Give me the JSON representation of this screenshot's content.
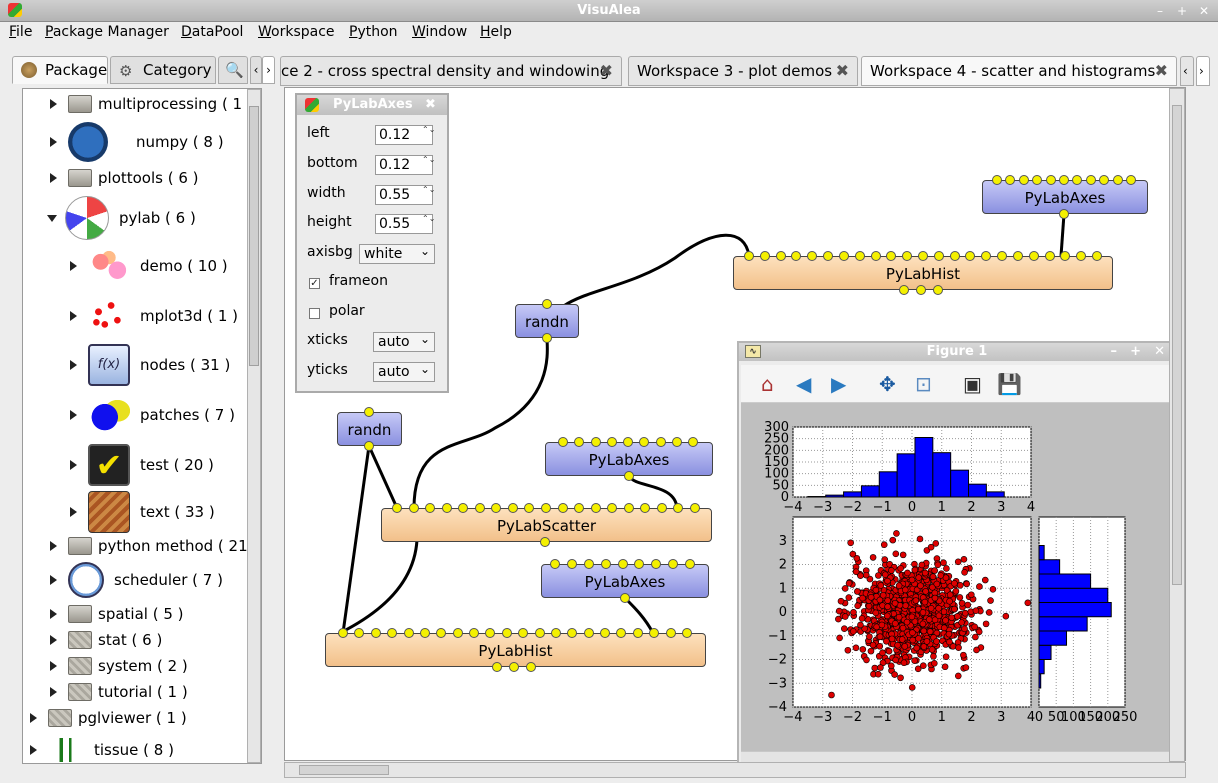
{
  "window": {
    "title": "VisuAlea"
  },
  "menu": [
    "File",
    "Package Manager",
    "DataPool",
    "Workspace",
    "Python",
    "Window",
    "Help"
  ],
  "left_tabs": {
    "package": "Package",
    "category": "Category"
  },
  "tree": [
    {
      "label": "multiprocessing ( 1 )",
      "icon": "folder-icon"
    },
    {
      "label": "numpy ( 8 )",
      "icon": "numpy-icon"
    },
    {
      "label": "plottools ( 6 )",
      "icon": "folder-icon"
    },
    {
      "label": "pylab ( 6 )",
      "icon": "pylab-icon"
    },
    {
      "label": "demo ( 10 )",
      "icon": "demo-icon"
    },
    {
      "label": "mplot3d ( 1 )",
      "icon": "mplot3d-icon"
    },
    {
      "label": "nodes ( 31 )",
      "icon": "nodes-icon"
    },
    {
      "label": "patches ( 7 )",
      "icon": "patches-icon"
    },
    {
      "label": "test ( 20 )",
      "icon": "test-icon"
    },
    {
      "label": "text ( 33 )",
      "icon": "text-icon"
    },
    {
      "label": "python method ( 21 )",
      "icon": "folder-icon"
    },
    {
      "label": "scheduler ( 7 )",
      "icon": "clock-icon"
    },
    {
      "label": "spatial ( 5 )",
      "icon": "folder-icon"
    },
    {
      "label": "stat ( 6 )",
      "icon": "folder-icon"
    },
    {
      "label": "system ( 2 )",
      "icon": "folder-icon"
    },
    {
      "label": "tutorial ( 1 )",
      "icon": "folder-icon"
    },
    {
      "label": "pglviewer ( 1 )",
      "icon": "folder-icon"
    },
    {
      "label": "tissue ( 8 )",
      "icon": "tissue-icon"
    }
  ],
  "workspace_tabs": [
    "ce 2 - cross spectral density and windowing",
    "Workspace 3 - plot demos",
    "Workspace 4 - scatter and histograms"
  ],
  "nodes": {
    "pylabaxes_top": "PyLabAxes",
    "pylabhist_top": "PyLabHist",
    "randn_a": "randn",
    "randn_b": "randn",
    "pylabaxes_mid": "PyLabAxes",
    "pylabscatter": "PyLabScatter",
    "pylabaxes_low": "PyLabAxes",
    "pylabhist_bottom": "PyLabHist"
  },
  "dialog": {
    "title": "PyLabAxes",
    "left_label": "left",
    "left": "0.12",
    "bottom_label": "bottom",
    "bottom": "0.12",
    "width_label": "width",
    "width": "0.55",
    "height_label": "height",
    "height": "0.55",
    "axisbg_label": "axisbg",
    "axisbg": "white",
    "frameon_label": "frameon",
    "frameon": true,
    "polar_label": "polar",
    "polar": false,
    "xticks_label": "xticks",
    "xticks": "auto",
    "yticks_label": "yticks",
    "yticks": "auto"
  },
  "figure": {
    "title": "Figure 1"
  },
  "chart_data": [
    {
      "type": "bar",
      "title": "",
      "categories": [
        -3.2,
        -2.6,
        -2,
        -1.4,
        -0.8,
        -0.2,
        0.4,
        1,
        1.6,
        2.2,
        2.8
      ],
      "values": [
        2,
        8,
        22,
        48,
        108,
        185,
        255,
        190,
        115,
        55,
        22
      ],
      "xlim": [
        -4,
        4
      ],
      "ylim": [
        0,
        300
      ],
      "xticks": [
        "−4",
        "−3",
        "−2",
        "−1",
        "0",
        "1",
        "2",
        "3",
        "4"
      ],
      "yticks": [
        "0",
        "50",
        "100",
        "150",
        "200",
        "250",
        "300"
      ],
      "color": "#0000ff",
      "grid": true
    },
    {
      "type": "scatter",
      "title": "",
      "xlim": [
        -4,
        4
      ],
      "ylim": [
        -4,
        4
      ],
      "n_points": 1000,
      "xticks": [
        "−4",
        "−3",
        "−2",
        "−1",
        "0",
        "1",
        "2",
        "3",
        "4"
      ],
      "yticks": [
        "−4",
        "−3",
        "−2",
        "−1",
        "0",
        "1",
        "2",
        "3"
      ],
      "color": "#dd0000",
      "grid": true
    },
    {
      "type": "bar",
      "orientation": "horizontal",
      "title": "",
      "categories": [
        -2.9,
        -2.3,
        -1.7,
        -1.1,
        -0.5,
        0.1,
        0.7,
        1.3,
        1.9,
        2.5
      ],
      "values": [
        5,
        15,
        35,
        80,
        140,
        210,
        200,
        150,
        60,
        15
      ],
      "xlim": [
        0,
        250
      ],
      "xticks": [
        "0",
        "50",
        "100",
        "150",
        "200",
        "250"
      ],
      "color": "#0000ff",
      "grid": true
    }
  ]
}
